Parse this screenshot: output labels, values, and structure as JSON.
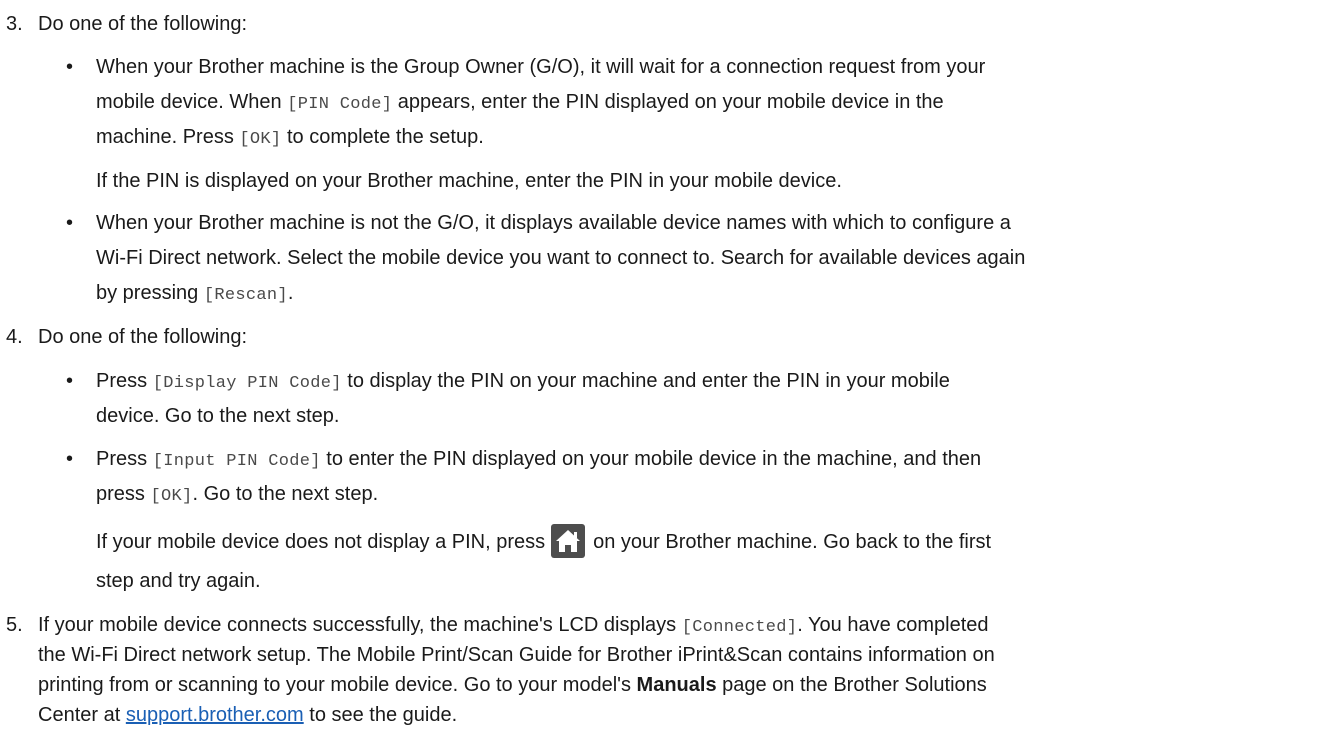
{
  "step3": {
    "number": "3.",
    "intro": "Do one of the following:",
    "bullet1": {
      "mark": "•",
      "l1": "When your Brother machine is the Group Owner (G/O), it will wait for a connection request from your",
      "l2a": "mobile device. When ",
      "l2code": "[PIN Code]",
      "l2b": " appears, enter the PIN displayed on your mobile device in the",
      "l3a": "machine. Press ",
      "l3code": "[OK]",
      "l3b": " to complete the setup.",
      "note": "If the PIN is displayed on your Brother machine, enter the PIN in your mobile device."
    },
    "bullet2": {
      "mark": "•",
      "l1": "When your Brother machine is not the G/O, it displays available device names with which to configure a",
      "l2": "Wi-Fi Direct network. Select the mobile device you want to connect to. Search for available devices again",
      "l3a": "by pressing ",
      "l3code": "[Rescan]",
      "l3b": "."
    }
  },
  "step4": {
    "number": "4.",
    "intro": "Do one of the following:",
    "bullet1": {
      "mark": "•",
      "l1a": "Press ",
      "l1code": "[Display PIN Code]",
      "l1b": " to display the PIN on your machine and enter the PIN in your mobile",
      "l2": "device. Go to the next step."
    },
    "bullet2": {
      "mark": "•",
      "l1a": "Press ",
      "l1code": "[Input PIN Code]",
      "l1b": " to enter the PIN displayed on your mobile device in the machine, and then",
      "l2a": "press ",
      "l2code": "[OK]",
      "l2b": ". Go to the next step."
    },
    "note": {
      "l1a": "If your mobile device does not display a PIN, press",
      "icon": "home-icon",
      "l1b": "on your Brother machine. Go back to the first",
      "l2": "step and try again."
    }
  },
  "step5": {
    "number": "5.",
    "l1a": "If your mobile device connects successfully, the machine's LCD displays ",
    "l1code": "[Connected]",
    "l1b": ". You have completed",
    "l2": "the Wi-Fi Direct network setup. The Mobile Print/Scan Guide for Brother iPrint&Scan contains information on",
    "l3a": "printing from or scanning to your mobile device. Go to your model's ",
    "l3bold": "Manuals",
    "l3b": " page on the Brother Solutions",
    "l4a": "Center at ",
    "l4link": "support.brother.com",
    "l4b": " to see the guide."
  },
  "colors": {
    "text": "#1a1a1a",
    "code": "#4a4a4a",
    "link": "#1a5fb4",
    "icon_bg": "#4d4d4d"
  }
}
